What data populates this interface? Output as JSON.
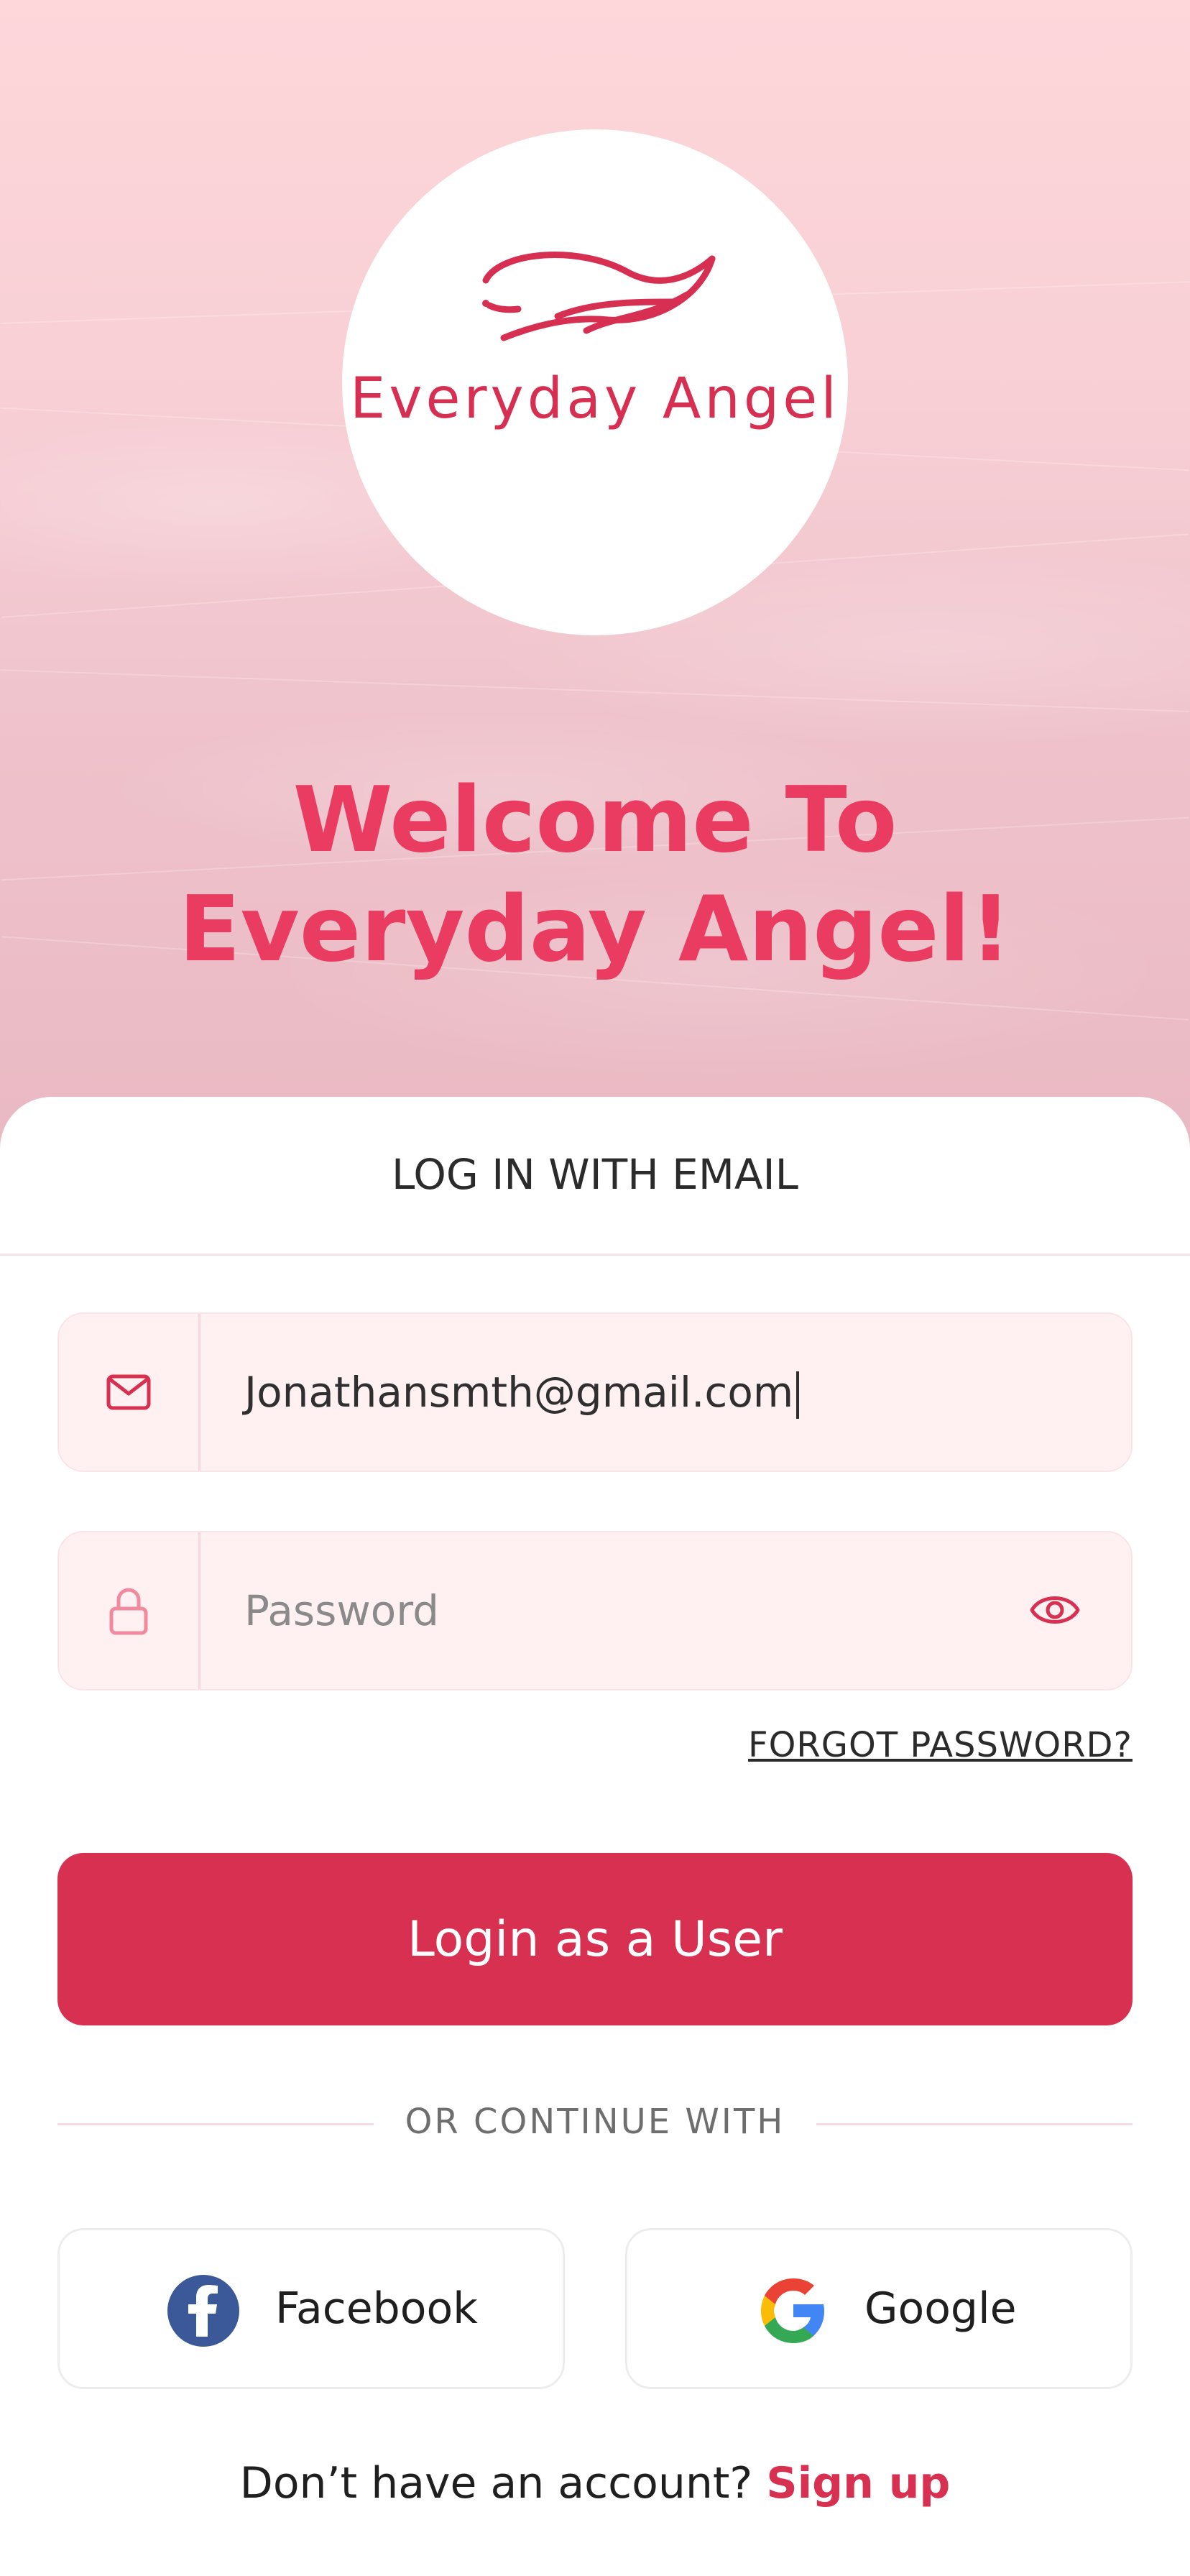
{
  "brand": {
    "logo_text": "Everyday Angel",
    "colors": {
      "primary": "#d83050",
      "heading": "#e93c60",
      "field_bg": "#fff0f2"
    }
  },
  "hero": {
    "welcome_line1": "Welcome To",
    "welcome_line2": "Everyday Angel!"
  },
  "login": {
    "title": "LOG IN WITH EMAIL",
    "email": {
      "icon": "mail-icon",
      "value": "Jonathansmth@gmail.com"
    },
    "password": {
      "icon": "lock-icon",
      "placeholder": "Password",
      "toggle_icon": "eye-icon"
    },
    "forgot_label": "FORGOT PASSWORD?",
    "submit_label": "Login as a User"
  },
  "social": {
    "divider_label": "OR CONTINUE WITH",
    "facebook_label": "Facebook",
    "google_label": "Google"
  },
  "footer": {
    "prompt": "Don’t have an account?",
    "signup_label": "Sign up"
  }
}
